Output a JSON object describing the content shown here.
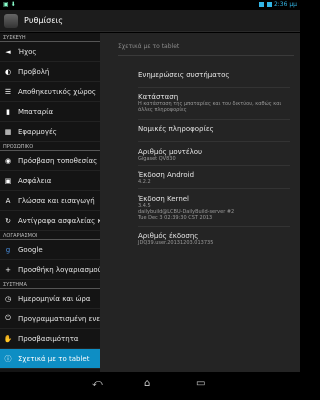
{
  "status_bar": {
    "time": "2:36",
    "ampm": "μμ"
  },
  "app_bar": {
    "title": "Ρυθμίσεις"
  },
  "sidebar": {
    "sections": [
      {
        "header": "ΣΥΣΚΕΥΗ",
        "items": [
          {
            "label": "Ήχος",
            "icon": "speaker-icon"
          },
          {
            "label": "Προβολή",
            "icon": "brightness-icon"
          },
          {
            "label": "Αποθηκευτικός χώρος",
            "icon": "storage-icon"
          },
          {
            "label": "Μπαταρία",
            "icon": "battery-icon"
          },
          {
            "label": "Εφαρμογές",
            "icon": "apps-icon"
          }
        ]
      },
      {
        "header": "ΠΡΟΣΩΠΙΚΟ",
        "items": [
          {
            "label": "Πρόσβαση τοποθεσίας",
            "icon": "location-icon"
          },
          {
            "label": "Ασφάλεια",
            "icon": "lock-icon"
          },
          {
            "label": "Γλώσσα και εισαγωγή",
            "icon": "language-icon"
          },
          {
            "label": "Αντίγραφα ασφαλείας κ",
            "icon": "backup-icon"
          }
        ]
      },
      {
        "header": "ΛΟΓΑΡΙΑΣΜΟΙ",
        "items": [
          {
            "label": "Google",
            "icon": "google-icon"
          },
          {
            "label": "Προσθήκη λογαριασμού",
            "icon": "plus-icon"
          }
        ]
      },
      {
        "header": "ΣΥΣΤΗΜΑ",
        "items": [
          {
            "label": "Ημερομηνία και ώρα",
            "icon": "clock-icon"
          },
          {
            "label": "Προγραμματισμένη ενερ",
            "icon": "power-schedule-icon"
          },
          {
            "label": "Προσβασιμότητα",
            "icon": "accessibility-icon"
          },
          {
            "label": "Σχετικά με το tablet",
            "icon": "info-icon",
            "active": true
          }
        ]
      }
    ]
  },
  "main": {
    "header": "Σχετικά με το tablet",
    "items": [
      {
        "title": "Ενημερώσεις συστήματος",
        "summary": ""
      },
      {
        "title": "Κατάσταση",
        "summary": "Η κατάσταση της μπαταρίας και του δικτύου, καθώς και άλλες πληροφορίες"
      },
      {
        "title": "Νομικές πληροφορίες",
        "summary": ""
      },
      {
        "title": "Αριθμός μοντέλου",
        "summary": "Gigaset QV830"
      },
      {
        "title": "Έκδοση Android",
        "summary": "4.2.2"
      },
      {
        "title": "Έκδοση Kernel",
        "summary": "3.4.5\ndailybuild@LCBU-DailyBuild-server #2\nTue Dec 3 02:39:30 CST 2013"
      },
      {
        "title": "Αριθμός έκδοσης",
        "summary": "JDQ39.user.20131203.013735"
      }
    ]
  },
  "nav_bar": {
    "back": "⤺",
    "home": "⌂",
    "recents": "▭"
  }
}
